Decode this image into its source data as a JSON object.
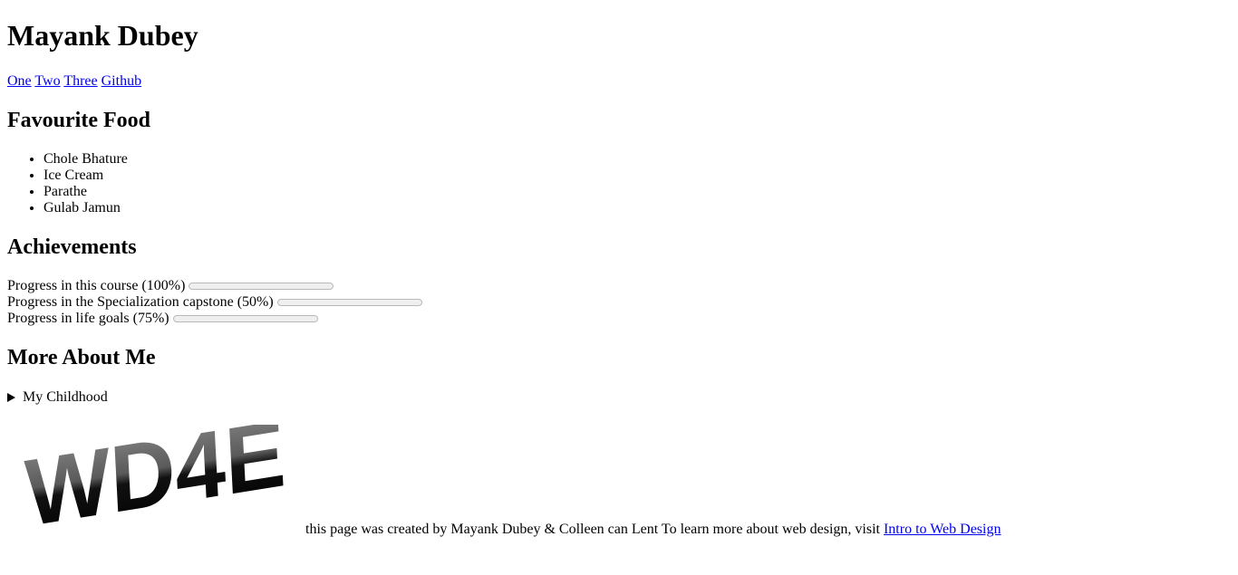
{
  "header": {
    "name": "Mayank Dubey"
  },
  "nav": {
    "links": [
      "One",
      "Two",
      "Three",
      "Github"
    ]
  },
  "food": {
    "heading": "Favourite Food",
    "items": [
      "Chole Bhature",
      "Ice Cream",
      "Parathe",
      "Gulab Jamun"
    ]
  },
  "achievements": {
    "heading": "Achievements",
    "items": [
      {
        "label": "Progress in this course (100%)",
        "value": 1.0
      },
      {
        "label": "Progress in the Specialization capstone (50%)",
        "value": 0.5
      },
      {
        "label": "Progress in life goals (75%)",
        "value": 0.75
      }
    ]
  },
  "more": {
    "heading": "More About Me",
    "summary": "My Childhood"
  },
  "footer": {
    "logo_text": "WD4E",
    "text": "this page was created by Mayank Dubey & Colleen can Lent To learn more about web design, visit",
    "link": "Intro to Web Design"
  },
  "colors": {
    "progress_fill": "#0b74e8",
    "link": "#0000ee"
  }
}
